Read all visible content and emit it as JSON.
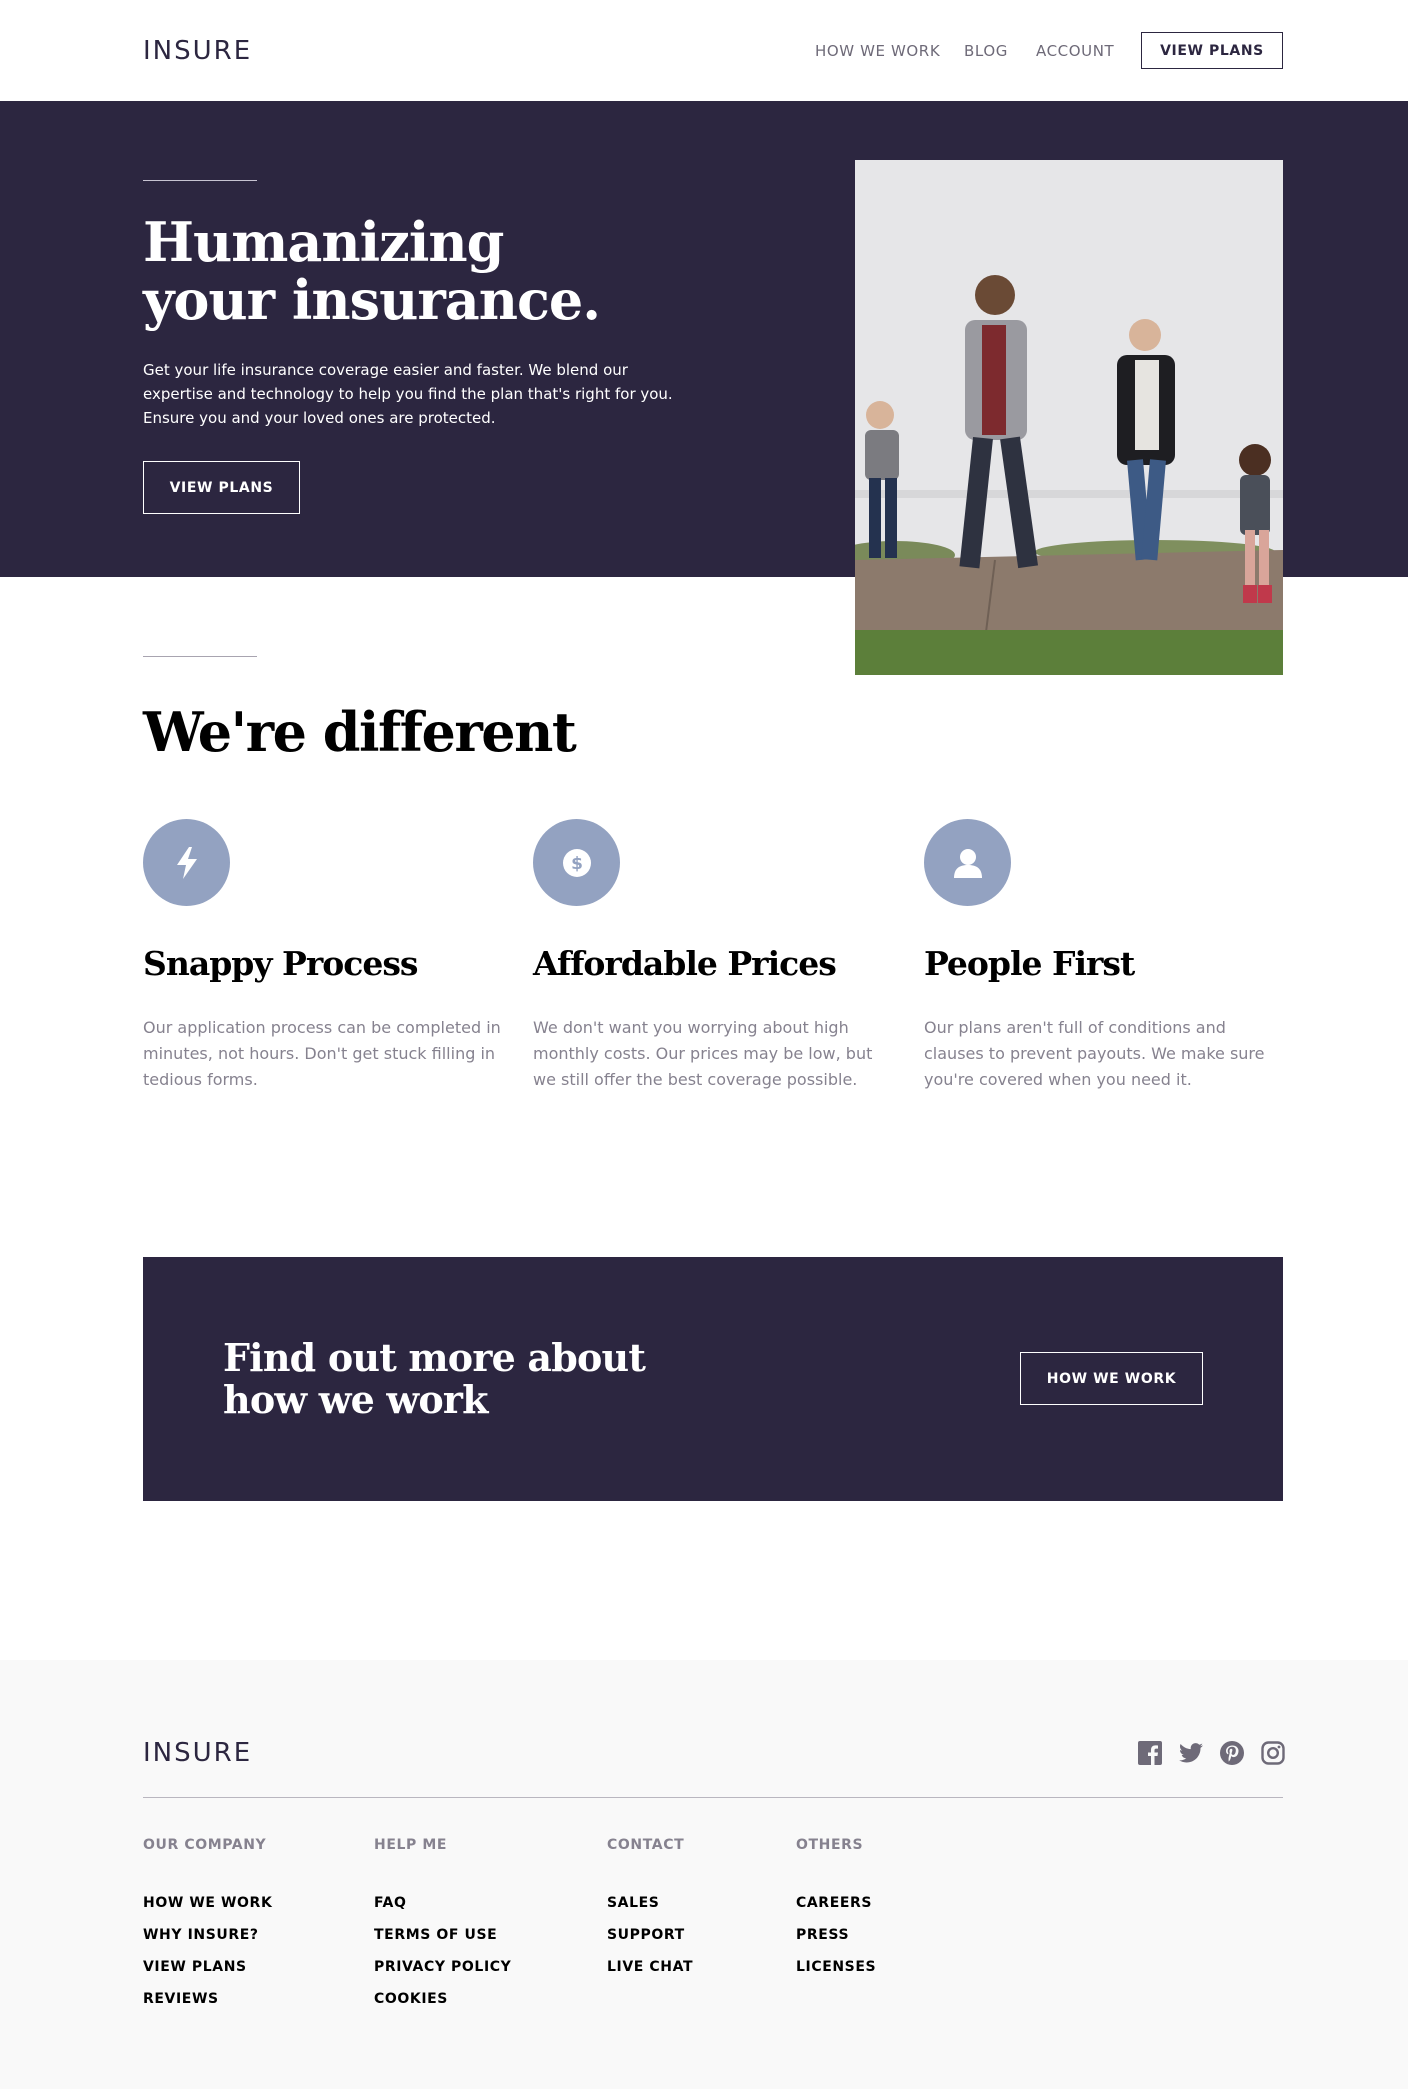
{
  "header": {
    "logo": "INSURE",
    "nav": [
      "HOW WE WORK",
      "BLOG",
      "ACCOUNT"
    ],
    "cta_label": "VIEW PLANS"
  },
  "hero": {
    "title_line1": "Humanizing",
    "title_line2": "your insurance.",
    "text": "Get your life insurance coverage easier and faster. We blend our expertise and technology to help you find the plan that's right for you. Ensure you and your loved ones are protected.",
    "button_label": "VIEW PLANS"
  },
  "different": {
    "title": "We're different",
    "features": [
      {
        "icon": "lightning-icon",
        "title": "Snappy Process",
        "text": "Our application process can be completed in minutes, not hours. Don't get stuck filling in tedious forms."
      },
      {
        "icon": "dollar-icon",
        "title": "Affordable Prices",
        "text": "We don't want you worrying about high monthly costs. Our prices may be low, but we still offer the best coverage possible."
      },
      {
        "icon": "person-icon",
        "title": "People First",
        "text": "Our plans aren't full of conditions and clauses to prevent payouts. We make sure you're covered when you need it."
      }
    ]
  },
  "cta": {
    "title_line1": "Find out more about",
    "title_line2": "how we work",
    "button_label": "HOW WE WORK"
  },
  "footer": {
    "logo": "INSURE",
    "socials": [
      "facebook-icon",
      "twitter-icon",
      "pinterest-icon",
      "instagram-icon"
    ],
    "columns": [
      {
        "title": "OUR COMPANY",
        "links": [
          "HOW WE WORK",
          "WHY INSURE?",
          "VIEW PLANS",
          "REVIEWS"
        ]
      },
      {
        "title": "HELP ME",
        "links": [
          "FAQ",
          "TERMS OF USE",
          "PRIVACY POLICY",
          "COOKIES"
        ]
      },
      {
        "title": "CONTACT",
        "links": [
          "SALES",
          "SUPPORT",
          "LIVE CHAT"
        ]
      },
      {
        "title": "OTHERS",
        "links": [
          "CAREERS",
          "PRESS",
          "LICENSES"
        ]
      }
    ]
  },
  "colors": {
    "dark_violet": "#2c2640",
    "icon_blue": "#93a2c1",
    "grey_text": "#86828f",
    "footer_bg": "#f9f9f9"
  }
}
